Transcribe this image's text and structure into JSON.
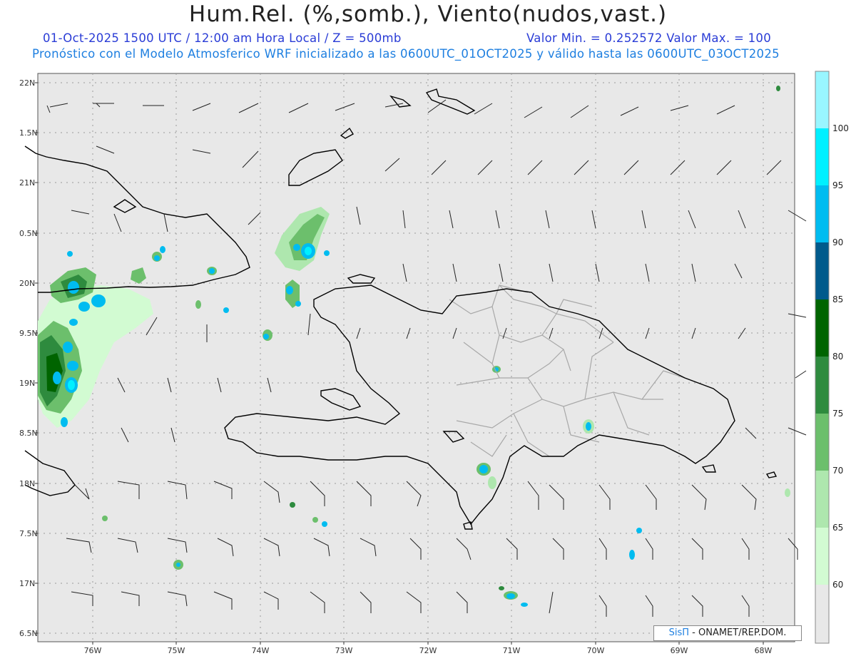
{
  "header": {
    "title": "Hum.Rel. (%,somb.), Viento(nudos,vast.)",
    "valid_time": "01-Oct-2025  1500 UTC / 12:00 am Hora Local / Z = 500mb",
    "value_range": "Valor Min. = 0.252572  Valor Max. = 100",
    "model_info": "Pronóstico con el Modelo Atmosferico WRF inicializado a las 0600UTC_01OCT2025 y válido hasta las  0600UTC_03OCT2025"
  },
  "axes": {
    "lat_labels": [
      "22N",
      "1.5N",
      "21N",
      "0.5N",
      "20N",
      "9.5N",
      "19N",
      "8.5N",
      "18N",
      "7.5N",
      "17N",
      "6.5N"
    ],
    "lon_labels": [
      "76W",
      "75W",
      "74W",
      "73W",
      "72W",
      "71W",
      "70W",
      "69W",
      "68W"
    ]
  },
  "colorbar": {
    "levels": [
      "100",
      "95",
      "90",
      "85",
      "80",
      "75",
      "70",
      "65",
      "60"
    ],
    "colors": [
      "#99f6ff",
      "#00f0ff",
      "#00bcf0",
      "#005a8c",
      "#006400",
      "#2e8b3e",
      "#6cbf6c",
      "#aee7ae",
      "#d2fbd2",
      "#e8e8e8"
    ]
  },
  "credit": {
    "brand": "SisΠ",
    "text": "- ONAMET/REP.DOM."
  },
  "colors": {
    "map_background": "#e8e8e8",
    "coastline": "#000000",
    "province_border": "#a8a8a8",
    "grid": "#9a9a9a"
  }
}
